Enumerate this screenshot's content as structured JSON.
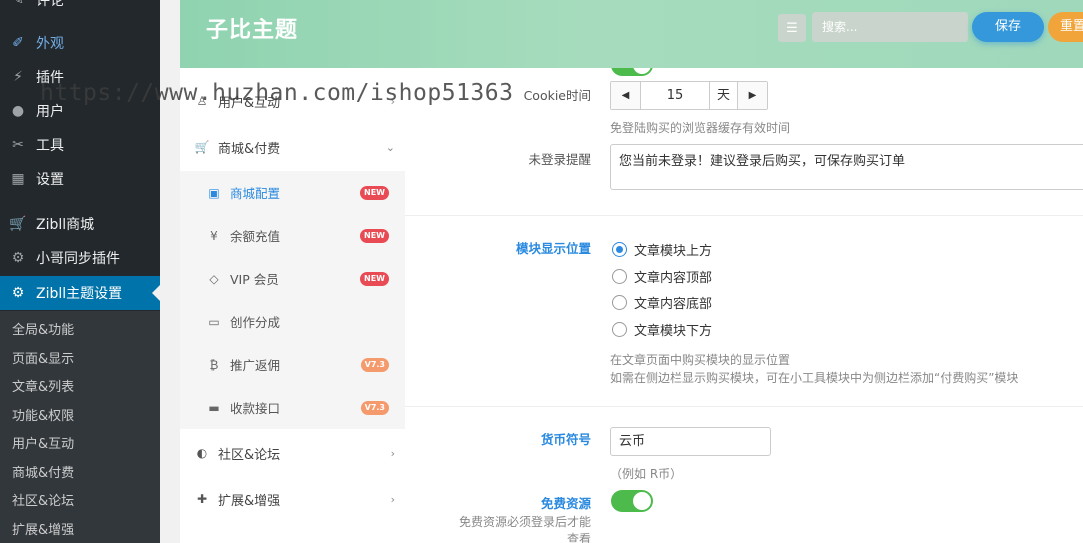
{
  "wp_sidebar": {
    "items": [
      {
        "label": "评论",
        "icon": "comment-icon"
      },
      {
        "label": "外观",
        "icon": "appearance-icon"
      },
      {
        "label": "插件",
        "icon": "plugin-icon"
      },
      {
        "label": "用户",
        "icon": "user-icon"
      },
      {
        "label": "工具",
        "icon": "wrench-icon"
      },
      {
        "label": "设置",
        "icon": "settings-icon"
      },
      {
        "label": "Zibll商城",
        "icon": "cart-icon"
      },
      {
        "label": "小哥同步插件",
        "icon": "gear-icon"
      },
      {
        "label": "Zibll主题设置",
        "icon": "gear-icon"
      }
    ],
    "submenu": [
      "全局&功能",
      "页面&显示",
      "文章&列表",
      "功能&权限",
      "用户&互动",
      "商城&付费",
      "社区&论坛",
      "扩展&增强"
    ]
  },
  "header": {
    "title": "子比主题",
    "search_placeholder": "搜索...",
    "save_label": "保存",
    "reset_label": "重置"
  },
  "settings_nav": {
    "user_interaction": "用户&互动",
    "shop": "商城&付费",
    "sub_items": [
      {
        "label": "商城配置",
        "badge": "NEW",
        "icon": "bag-icon"
      },
      {
        "label": "余额充值",
        "badge": "NEW",
        "icon": "yen-icon"
      },
      {
        "label": "VIP 会员",
        "badge": "NEW",
        "icon": "diamond-icon"
      },
      {
        "label": "创作分成",
        "badge": "",
        "icon": "inbox-icon"
      },
      {
        "label": "推广返佣",
        "badge": "V7.3",
        "icon": "bitcoin-icon"
      },
      {
        "label": "收款接口",
        "badge": "V7.3",
        "icon": "card-icon"
      }
    ],
    "community": "社区&论坛",
    "extensions": "扩展&增强"
  },
  "main": {
    "cookie": {
      "label": "Cookie时间",
      "value": "15",
      "unit": "天",
      "help": "免登陆购买的浏览器缓存有效时间"
    },
    "login_prompt": {
      "label": "未登录提醒",
      "value": "您当前未登录！建议登录后购买，可保存购买订单"
    },
    "module_position": {
      "label": "模块显示位置",
      "options": [
        "文章模块上方",
        "文章内容顶部",
        "文章内容底部",
        "文章模块下方"
      ],
      "selected": "文章模块上方",
      "help1": "在文章页面中购买模块的显示位置",
      "help2": "如需在侧边栏显示购买模块，可在小工具模块中为侧边栏添加“付费购买”模块"
    },
    "currency": {
      "label": "货币符号",
      "value": "云币",
      "help": "（例如 R币）"
    },
    "free_resource": {
      "label": "免费资源",
      "help_line1": "免费资源必须登录后才能",
      "help_line2": "查看",
      "enabled": true
    }
  },
  "watermark": "https://www.huzhan.com/ishop51363"
}
